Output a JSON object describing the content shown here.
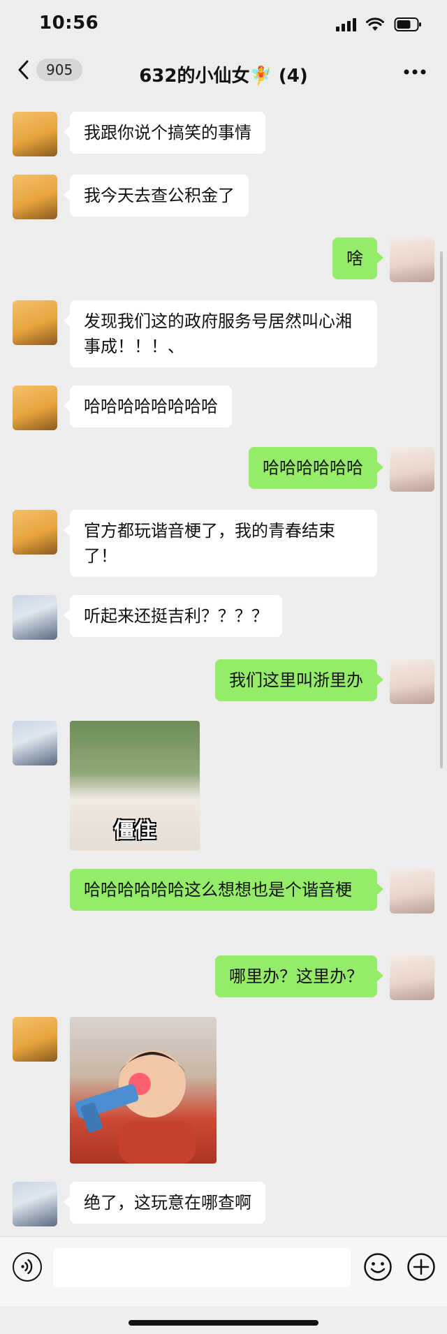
{
  "status_bar": {
    "time": "10:56"
  },
  "nav": {
    "back_count": "905",
    "title": "632的小仙女🧚 (4)"
  },
  "messages": [
    {
      "text": "我跟你说个搞笑的事情"
    },
    {
      "text": "我今天去查公积金了"
    },
    {
      "text": "啥"
    },
    {
      "text": "发现我们这的政府服务号居然叫心湘事成！！！、"
    },
    {
      "text": "哈哈哈哈哈哈哈哈"
    },
    {
      "text": "哈哈哈哈哈哈"
    },
    {
      "text": "官方都玩谐音梗了，我的青春结束了！"
    },
    {
      "text": "听起来还挺吉利？？？？"
    },
    {
      "text": "我们这里叫浙里办"
    },
    {
      "sticker_caption": "僵住"
    },
    {
      "text": "哈哈哈哈哈哈这么想想也是个谐音梗"
    },
    {
      "text": "哪里办？这里办？"
    },
    {
      "sticker_caption": ""
    },
    {
      "text": "绝了，这玩意在哪查啊"
    }
  ],
  "input": {
    "placeholder": ""
  },
  "colors": {
    "sent_bubble": "#95ec69",
    "received_bubble": "#ffffff",
    "background": "#ededed"
  }
}
